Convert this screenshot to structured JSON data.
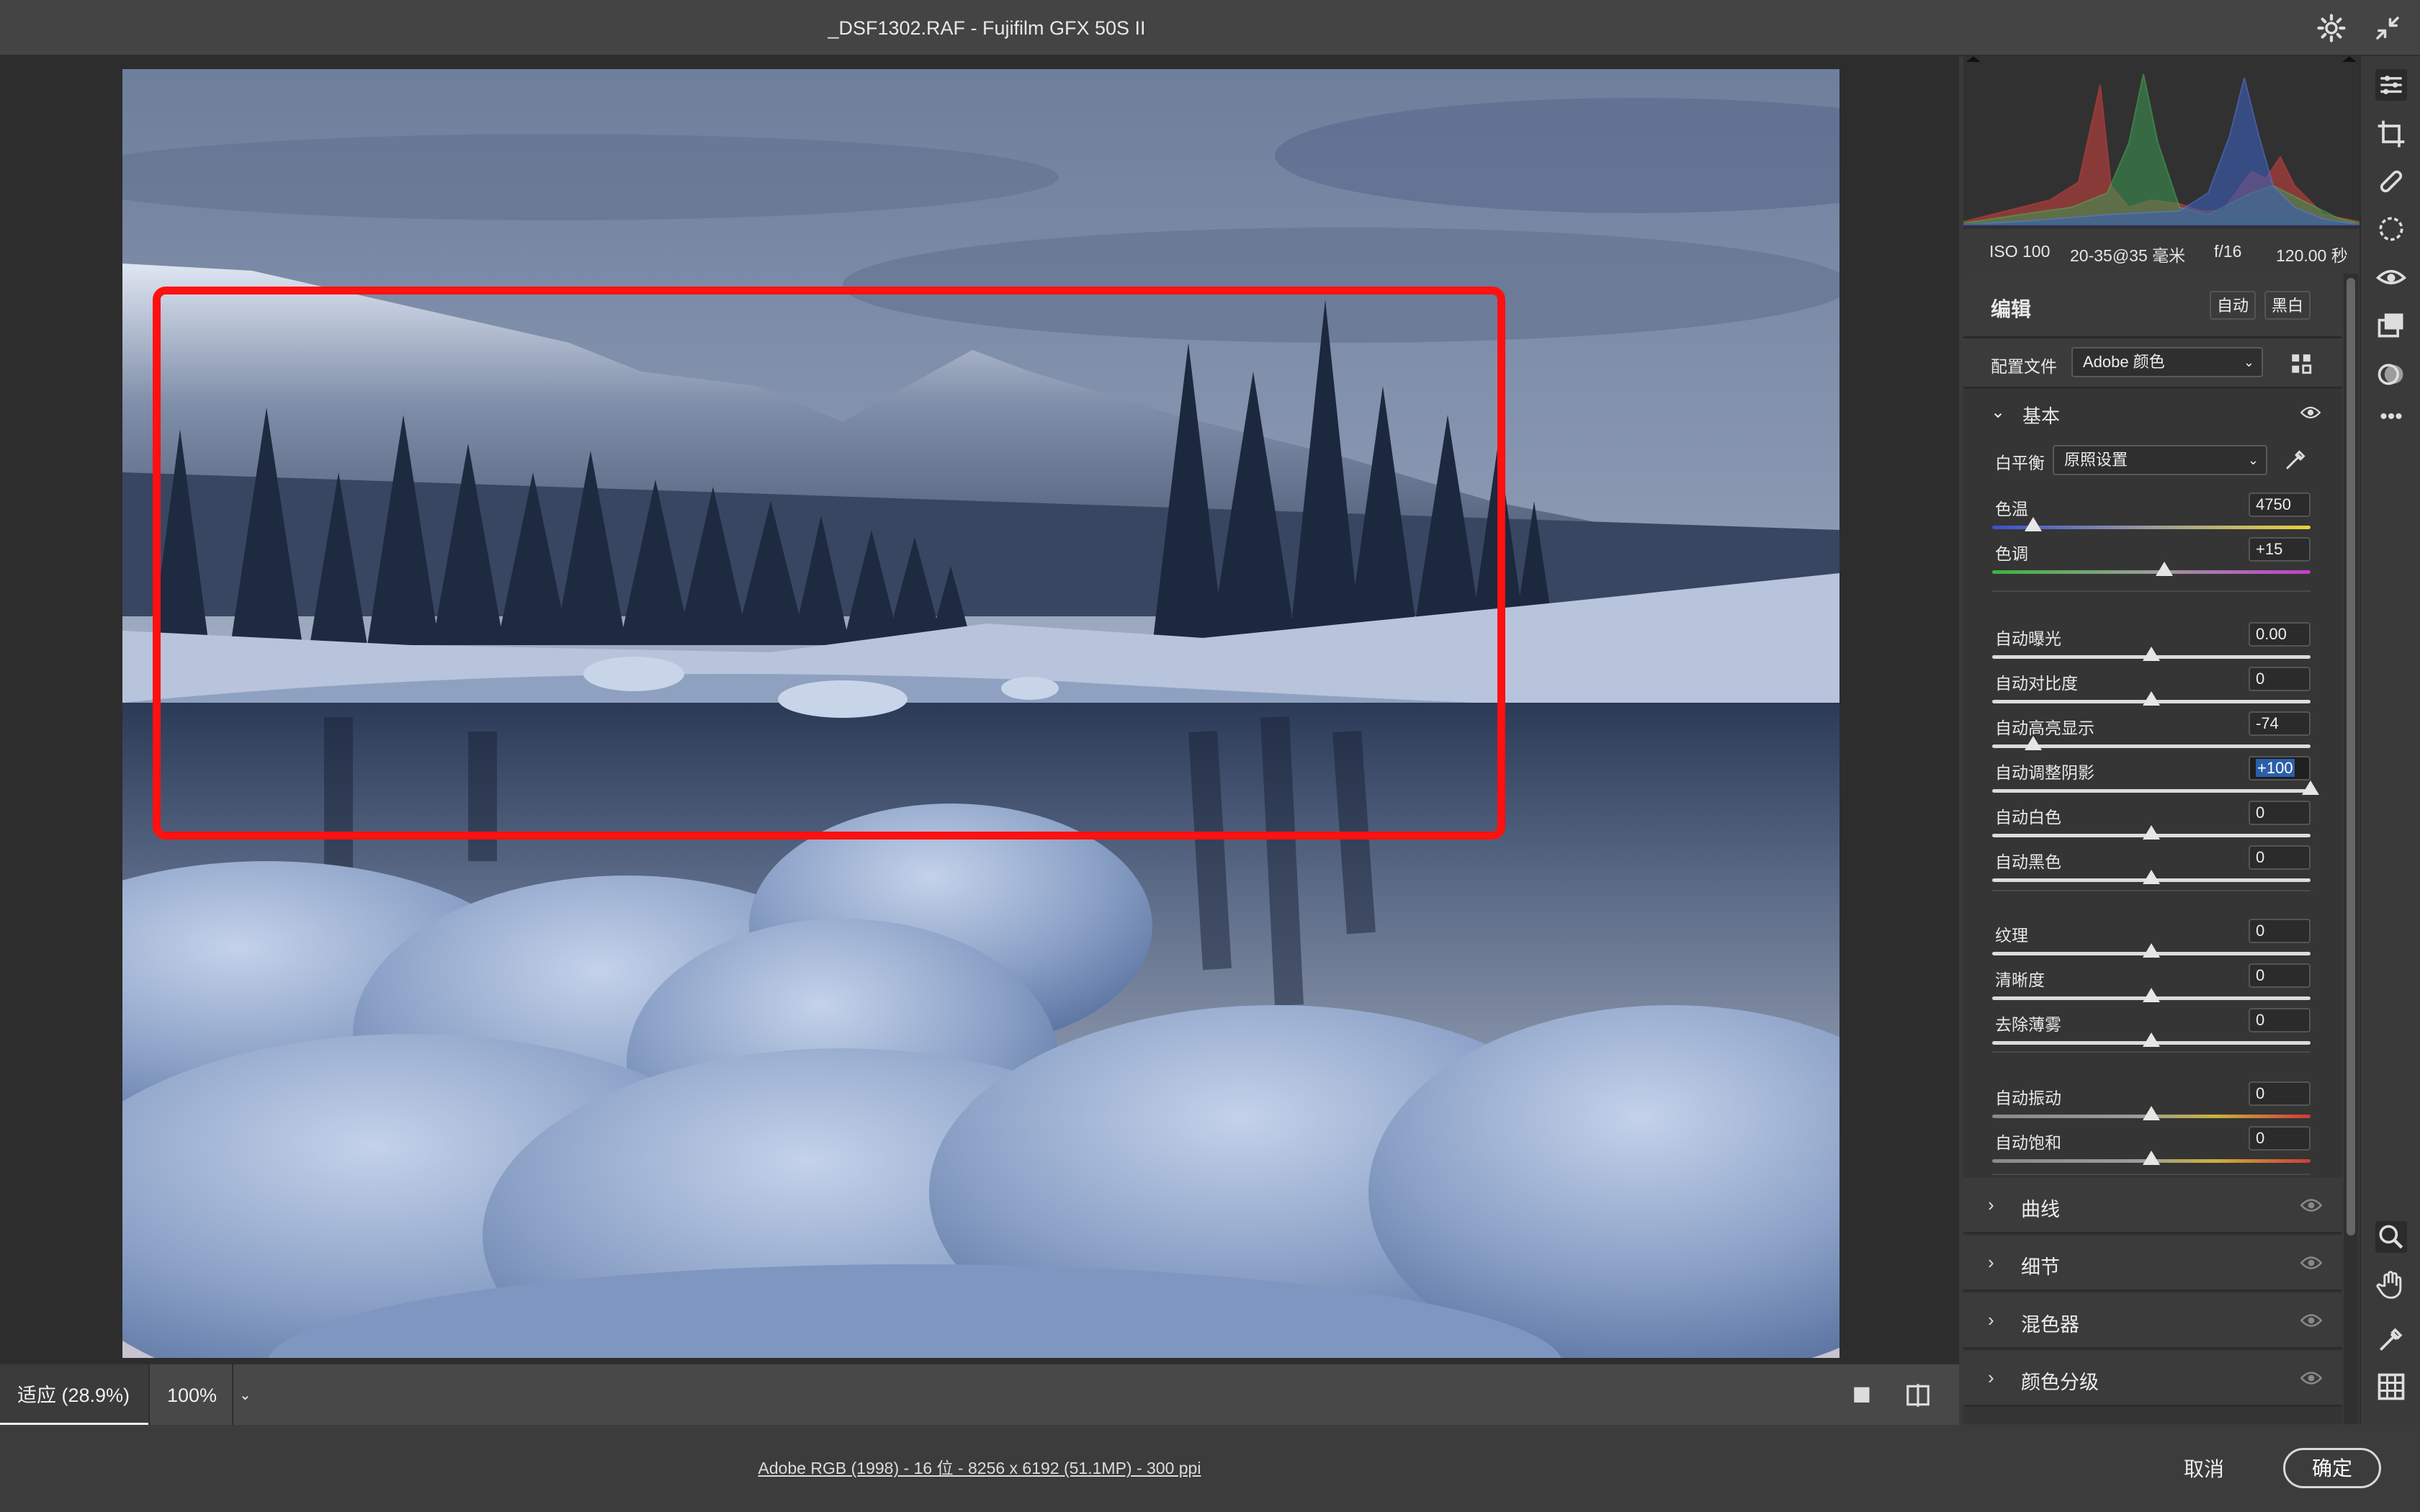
{
  "window": {
    "title": "_DSF1302.RAF -  Fujifilm GFX 50S II"
  },
  "exif": {
    "iso": "ISO 100",
    "lens": "20-35@35 毫米",
    "aperture": "f/16",
    "shutter": "120.00 秒"
  },
  "edit": {
    "title": "编辑",
    "auto_label": "自动",
    "bw_label": "黑白",
    "profile_label": "配置文件",
    "profile_value": "Adobe 颜色"
  },
  "basic": {
    "title": "基本",
    "wb_label": "白平衡",
    "wb_value": "原照设置",
    "sliders": [
      {
        "label": "色温",
        "value": "4750",
        "level": 0.13
      },
      {
        "label": "色调",
        "value": "+15",
        "level": 0.54
      },
      {
        "label": "自动曝光",
        "value": "0.00",
        "level": 0.5
      },
      {
        "label": "自动对比度",
        "value": "0",
        "level": 0.5
      },
      {
        "label": "自动高亮显示",
        "value": "-74",
        "level": 0.13
      },
      {
        "label": "自动调整阴影",
        "value": "+100",
        "level": 1.0
      },
      {
        "label": "自动白色",
        "value": "0",
        "level": 0.5
      },
      {
        "label": "自动黑色",
        "value": "0",
        "level": 0.5
      },
      {
        "label": "纹理",
        "value": "0",
        "level": 0.5
      },
      {
        "label": "清晰度",
        "value": "0",
        "level": 0.5
      },
      {
        "label": "去除薄雾",
        "value": "0",
        "level": 0.5
      },
      {
        "label": "自动振动",
        "value": "0",
        "level": 0.5
      },
      {
        "label": "自动饱和",
        "value": "0",
        "level": 0.5
      }
    ]
  },
  "sections": [
    {
      "label": "曲线"
    },
    {
      "label": "细节"
    },
    {
      "label": "混色器"
    },
    {
      "label": "颜色分级"
    }
  ],
  "zoom": {
    "fit": "适应 (28.9%)",
    "actual": "100%"
  },
  "footer": {
    "image_info": "Adobe RGB (1998) - 16 位 - 8256 x 6192 (51.1MP) - 300 ppi",
    "cancel": "取消",
    "ok": "确定"
  },
  "colors": {
    "accent": "#1a73e8",
    "highlight_box": "#ff1111",
    "panel_bg": "#353535",
    "active_value_bg": "#2b5fa8"
  }
}
